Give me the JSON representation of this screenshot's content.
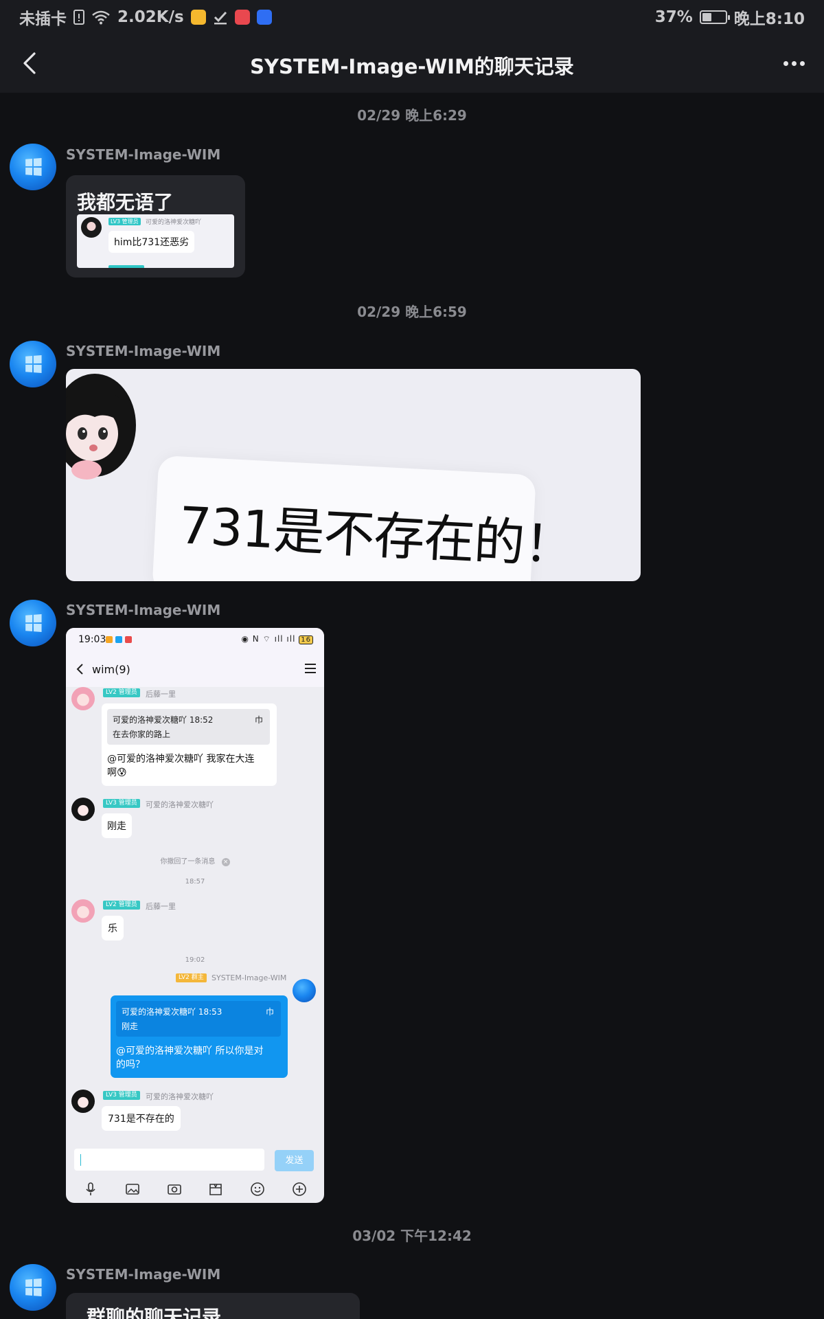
{
  "status_bar": {
    "carrier": "未插卡",
    "net_speed": "2.02K/s",
    "battery": "37%",
    "battery_level": 0.37,
    "time": "晚上8:10",
    "app_icons": [
      "mail-app-icon",
      "check-icon",
      "app-icon",
      "bulb-app-icon"
    ]
  },
  "header": {
    "title": "SYSTEM-Image-WIM的聊天记录",
    "back_icon": "chevron-left-icon",
    "more_icon": "more-dots-icon"
  },
  "messages": [
    {
      "timestamp": "02/29 晚上6:29",
      "sender": "SYSTEM-Image-WIM",
      "card": {
        "title": "我都无语了",
        "preview": {
          "badge": "LV3 管理员",
          "name": "可爱的洛神爱次糖吖",
          "text": "him比731还恶劣"
        }
      }
    },
    {
      "timestamp": "02/29 晚上6:59",
      "sender": "SYSTEM-Image-WIM",
      "image_text": "731是不存在的！"
    },
    {
      "sender": "SYSTEM-Image-WIM",
      "screenshot": {
        "time": "19:03",
        "status_right": "◉ N ⌔ ıll ıll",
        "battery": "16",
        "chat_title": "wim(9)",
        "items": [
          {
            "badge": "LV2 管理员",
            "name": "后藤一里",
            "quote_head": "可爱的洛神爱次糖吖 18:52",
            "quote_body": "在去你家的路上",
            "text_1": "@可爱的洛神爱次糖吖 我家在大连",
            "text_2": "啊😰"
          },
          {
            "badge": "LV3 管理员",
            "name": "可爱的洛神爱次糖吖",
            "text": "刚走"
          },
          {
            "system": "你撤回了一条消息"
          },
          {
            "time": "18:57"
          },
          {
            "badge": "LV2 管理员",
            "name": "后藤一里",
            "text": "乐"
          },
          {
            "time": "19:02"
          },
          {
            "badge": "LV2 群主",
            "name": "SYSTEM-Image-WIM",
            "quote_head": "可爱的洛神爱次糖吖 18:53",
            "quote_body": "刚走",
            "text_1": "@可爱的洛神爱次糖吖 所以你是对",
            "text_2": "的吗？"
          },
          {
            "badge": "LV3 管理员",
            "name": "可爱的洛神爱次糖吖",
            "text": "731是不存在的"
          }
        ],
        "send_label": "发送",
        "toolbar_icons": [
          "mic-icon",
          "image-icon",
          "camera-icon",
          "folder-icon",
          "emoji-icon",
          "plus-circle-icon"
        ]
      }
    },
    {
      "timestamp": "03/02 下午12:42",
      "sender": "SYSTEM-Image-WIM",
      "card": {
        "title": "群聊的聊天记录"
      }
    }
  ]
}
